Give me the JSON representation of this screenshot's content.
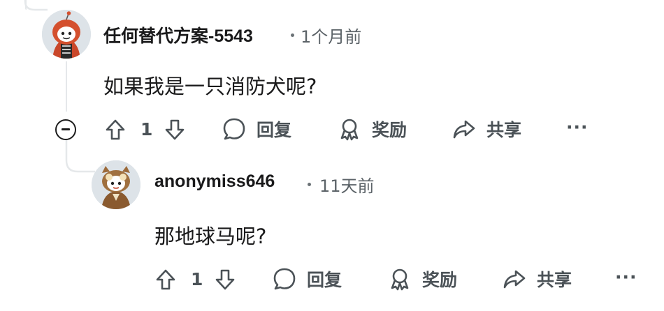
{
  "comments": [
    {
      "username": "任何替代方案-5543",
      "timestamp": "1个月前",
      "body": "如果我是一只消防犬呢?",
      "actions": {
        "score": "1",
        "reply_label": "回复",
        "award_label": "奖励",
        "share_label": "共享",
        "more_label": "···"
      }
    },
    {
      "username": "anonymiss646",
      "timestamp": "11天前",
      "body": "那地球马呢?",
      "actions": {
        "score": "1",
        "reply_label": "回复",
        "award_label": "奖励",
        "share_label": "共享",
        "more_label": "···"
      }
    }
  ],
  "colors": {
    "thread_line": "#e5e8ea",
    "action_text": "#4b5257",
    "meta_text": "#5c6368"
  },
  "icons": [
    "upvote-icon",
    "downvote-icon",
    "comment-icon",
    "award-icon",
    "share-icon",
    "more-icon",
    "collapse-icon"
  ]
}
